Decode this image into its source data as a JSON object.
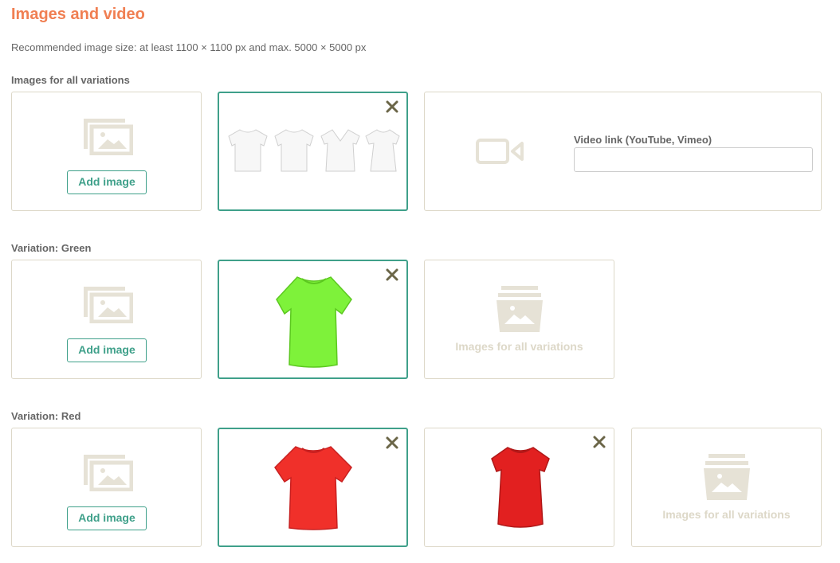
{
  "header": {
    "title": "Images and video",
    "hint": "Recommended image size: at least 1100 × 1100 px and max. 5000 × 5000 px"
  },
  "sections": {
    "all": {
      "label": "Images for all variations"
    },
    "green": {
      "label": "Variation: Green"
    },
    "red": {
      "label": "Variation: Red"
    }
  },
  "buttons": {
    "add_image": "Add image"
  },
  "video": {
    "label": "Video link (YouTube, Vimeo)",
    "value": ""
  },
  "inherited": {
    "label": "Images for all variations"
  },
  "colors": {
    "accent": "#3fa08a",
    "title": "#f07f52",
    "placeholder": "#ddd8c8",
    "green_shirt": "#7ef23a",
    "red_shirt": "#f0302a"
  },
  "icons": [
    "image-placeholder-icon",
    "close-icon",
    "video-icon",
    "stack-images-icon",
    "tshirt-image"
  ]
}
